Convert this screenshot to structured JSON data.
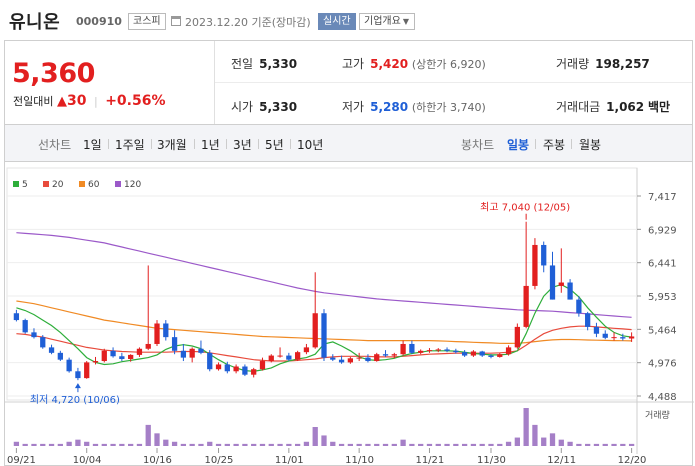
{
  "header": {
    "name": "유니온",
    "code": "000910",
    "market": "코스피",
    "date": "2023.12.20  기준(장마감)",
    "live_label": "실시간",
    "info_label": "기업개요"
  },
  "summary": {
    "price": "5,360",
    "change_label": "전일대비",
    "change": "30",
    "change_pct": "+0.56%",
    "prev_label": "전일",
    "prev": "5,330",
    "high_label": "고가",
    "high": "5,420",
    "upper_limit": "(상한가 6,920)",
    "volume_label": "거래량",
    "volume": "198,257",
    "open_label": "시가",
    "open": "5,330",
    "low_label": "저가",
    "low": "5,280",
    "lower_limit": "(하한가 3,740)",
    "amount_label": "거래대금",
    "amount": "1,062",
    "amount_unit": "백만"
  },
  "periods": {
    "line_label": "선차트",
    "line_items": [
      "1일",
      "1주일",
      "3개월",
      "1년",
      "3년",
      "5년",
      "10년"
    ],
    "candle_label": "봉차트",
    "candle_items": [
      "일봉",
      "주봉",
      "월봉"
    ],
    "active": "일봉"
  },
  "colors": {
    "up": "#e21f1f",
    "down": "#1f5fd6",
    "ma5": "#2eae3a",
    "ma20": "#e84b3c",
    "ma60": "#f08a24",
    "ma120": "#9b59c9"
  },
  "chart_data": {
    "type": "candlestick",
    "legend": [
      "5",
      "20",
      "60",
      "120"
    ],
    "y_ticks": [
      "7,417",
      "6,929",
      "6,441",
      "5,953",
      "5,464",
      "4,976",
      "4,488"
    ],
    "ylim": [
      4488,
      7417
    ],
    "x_ticks": [
      "09/21",
      "10/04",
      "10/16",
      "10/25",
      "11/01",
      "11/10",
      "11/21",
      "11/30",
      "12/11",
      "12/20"
    ],
    "max_annotation": "최고 7,040 (12/05)",
    "min_annotation": "최저 4,720 (10/06)",
    "volume_label": "거래량",
    "candles": [
      [
        5700,
        5750,
        5580,
        5600
      ],
      [
        5600,
        5620,
        5400,
        5420
      ],
      [
        5420,
        5480,
        5330,
        5350
      ],
      [
        5350,
        5380,
        5180,
        5200
      ],
      [
        5200,
        5240,
        5100,
        5120
      ],
      [
        5120,
        5150,
        5000,
        5020
      ],
      [
        5020,
        5050,
        4830,
        4850
      ],
      [
        4850,
        4900,
        4720,
        4750
      ],
      [
        4750,
        5000,
        4740,
        4980
      ],
      [
        4980,
        5060,
        4950,
        5000
      ],
      [
        5000,
        5180,
        4980,
        5150
      ],
      [
        5150,
        5200,
        5050,
        5070
      ],
      [
        5070,
        5120,
        5000,
        5030
      ],
      [
        5030,
        5100,
        4990,
        5090
      ],
      [
        5090,
        5200,
        5060,
        5180
      ],
      [
        5180,
        6400,
        5160,
        5250
      ],
      [
        5250,
        5600,
        5220,
        5550
      ],
      [
        5550,
        5600,
        5300,
        5350
      ],
      [
        5350,
        5450,
        5100,
        5150
      ],
      [
        5150,
        5250,
        5000,
        5050
      ],
      [
        5050,
        5200,
        4980,
        5180
      ],
      [
        5180,
        5300,
        5100,
        5120
      ],
      [
        5120,
        5160,
        4850,
        4880
      ],
      [
        4880,
        4980,
        4860,
        4950
      ],
      [
        4950,
        4990,
        4820,
        4850
      ],
      [
        4850,
        4950,
        4820,
        4920
      ],
      [
        4920,
        4950,
        4780,
        4800
      ],
      [
        4800,
        4900,
        4760,
        4880
      ],
      [
        4880,
        5050,
        4860,
        5000
      ],
      [
        5000,
        5100,
        4980,
        5080
      ],
      [
        5080,
        5200,
        5050,
        5080
      ],
      [
        5080,
        5120,
        5000,
        5020
      ],
      [
        5020,
        5150,
        5000,
        5130
      ],
      [
        5130,
        5250,
        5100,
        5200
      ],
      [
        5200,
        6300,
        5180,
        5700
      ],
      [
        5700,
        5760,
        5000,
        5050
      ],
      [
        5050,
        5100,
        5000,
        5020
      ],
      [
        5020,
        5080,
        4960,
        4980
      ],
      [
        4980,
        5060,
        4960,
        5040
      ],
      [
        5040,
        5120,
        5000,
        5050
      ],
      [
        5050,
        5100,
        4980,
        5000
      ],
      [
        5000,
        5120,
        4990,
        5100
      ],
      [
        5100,
        5160,
        5060,
        5080
      ],
      [
        5080,
        5120,
        5040,
        5100
      ],
      [
        5100,
        5300,
        5080,
        5250
      ],
      [
        5250,
        5300,
        5100,
        5120
      ],
      [
        5120,
        5170,
        5100,
        5150
      ],
      [
        5150,
        5190,
        5120,
        5160
      ],
      [
        5160,
        5190,
        5130,
        5170
      ],
      [
        5170,
        5200,
        5130,
        5150
      ],
      [
        5150,
        5180,
        5110,
        5130
      ],
      [
        5130,
        5160,
        5060,
        5080
      ],
      [
        5080,
        5160,
        5060,
        5140
      ],
      [
        5140,
        5150,
        5060,
        5080
      ],
      [
        5080,
        5100,
        5040,
        5060
      ],
      [
        5060,
        5120,
        5050,
        5100
      ],
      [
        5100,
        5230,
        5080,
        5200
      ],
      [
        5200,
        5550,
        5180,
        5500
      ],
      [
        5500,
        7040,
        5480,
        6100
      ],
      [
        6100,
        6800,
        6050,
        6700
      ],
      [
        6700,
        6750,
        6300,
        6400
      ],
      [
        6400,
        6600,
        5900,
        5900
      ],
      [
        6100,
        6650,
        6000,
        6150
      ],
      [
        6150,
        6200,
        5900,
        5900
      ],
      [
        5900,
        5950,
        5650,
        5700
      ],
      [
        5700,
        5720,
        5450,
        5500
      ],
      [
        5500,
        5560,
        5350,
        5400
      ],
      [
        5400,
        5450,
        5320,
        5340
      ],
      [
        5340,
        5420,
        5300,
        5350
      ],
      [
        5350,
        5400,
        5300,
        5330
      ],
      [
        5330,
        5420,
        5280,
        5360
      ]
    ],
    "volumes": [
      2,
      1,
      1,
      1,
      1,
      1,
      2,
      3,
      2,
      1,
      1,
      1,
      1,
      1,
      1,
      10,
      6,
      3,
      2,
      1,
      1,
      1,
      2,
      1,
      1,
      1,
      1,
      1,
      1,
      1,
      1,
      1,
      1,
      2,
      9,
      5,
      2,
      1,
      1,
      1,
      1,
      1,
      1,
      1,
      3,
      1,
      1,
      1,
      1,
      1,
      1,
      1,
      1,
      1,
      1,
      1,
      2,
      4,
      18,
      10,
      4,
      6,
      3,
      2,
      1,
      1,
      1,
      1,
      1,
      1,
      1
    ],
    "ma5": [
      5780,
      5740,
      5680,
      5600,
      5520,
      5420,
      5300,
      5180,
      5050,
      4980,
      4950,
      4960,
      4990,
      5010,
      5030,
      5050,
      5090,
      5170,
      5220,
      5240,
      5220,
      5180,
      5100,
      5020,
      4950,
      4900,
      4860,
      4850,
      4870,
      4900,
      4960,
      5000,
      5030,
      5050,
      5100,
      5250,
      5280,
      5220,
      5150,
      5060,
      5020,
      5010,
      5020,
      5040,
      5080,
      5110,
      5130,
      5150,
      5150,
      5150,
      5145,
      5130,
      5110,
      5100,
      5090,
      5090,
      5100,
      5150,
      5400,
      5700,
      5950,
      6080,
      6120,
      6050,
      5940,
      5780,
      5640,
      5510,
      5420,
      5370,
      5350
    ],
    "ma20": [
      5400,
      5390,
      5370,
      5350,
      5320,
      5290,
      5260,
      5230,
      5200,
      5180,
      5160,
      5150,
      5140,
      5135,
      5130,
      5130,
      5130,
      5130,
      5135,
      5140,
      5140,
      5135,
      5120,
      5100,
      5080,
      5060,
      5040,
      5020,
      5010,
      5000,
      5000,
      5000,
      5010,
      5020,
      5030,
      5050,
      5060,
      5070,
      5070,
      5070,
      5070,
      5060,
      5060,
      5060,
      5070,
      5080,
      5090,
      5100,
      5105,
      5110,
      5115,
      5115,
      5115,
      5115,
      5115,
      5120,
      5130,
      5150,
      5230,
      5320,
      5400,
      5450,
      5480,
      5500,
      5510,
      5510,
      5500,
      5490,
      5480,
      5470,
      5460
    ],
    "ma60": [
      5880,
      5860,
      5840,
      5810,
      5780,
      5750,
      5720,
      5690,
      5660,
      5630,
      5600,
      5580,
      5560,
      5540,
      5520,
      5500,
      5480,
      5470,
      5460,
      5450,
      5440,
      5430,
      5420,
      5410,
      5400,
      5390,
      5380,
      5370,
      5360,
      5355,
      5350,
      5345,
      5340,
      5335,
      5330,
      5325,
      5320,
      5315,
      5310,
      5305,
      5300,
      5300,
      5300,
      5300,
      5300,
      5300,
      5300,
      5300,
      5295,
      5290,
      5285,
      5280,
      5275,
      5270,
      5265,
      5260,
      5258,
      5260,
      5270,
      5285,
      5300,
      5310,
      5315,
      5315,
      5312,
      5308,
      5305,
      5302,
      5300,
      5298,
      5295
    ],
    "ma120": [
      6880,
      6870,
      6860,
      6850,
      6840,
      6825,
      6810,
      6790,
      6770,
      6750,
      6730,
      6700,
      6670,
      6640,
      6610,
      6580,
      6550,
      6520,
      6490,
      6460,
      6430,
      6400,
      6370,
      6340,
      6310,
      6280,
      6250,
      6220,
      6190,
      6160,
      6130,
      6100,
      6070,
      6045,
      6020,
      6000,
      5985,
      5970,
      5955,
      5940,
      5925,
      5910,
      5900,
      5890,
      5880,
      5870,
      5860,
      5850,
      5840,
      5830,
      5820,
      5810,
      5800,
      5790,
      5780,
      5770,
      5760,
      5750,
      5745,
      5740,
      5735,
      5730,
      5720,
      5710,
      5700,
      5690,
      5680,
      5670,
      5660,
      5650,
      5640
    ]
  }
}
